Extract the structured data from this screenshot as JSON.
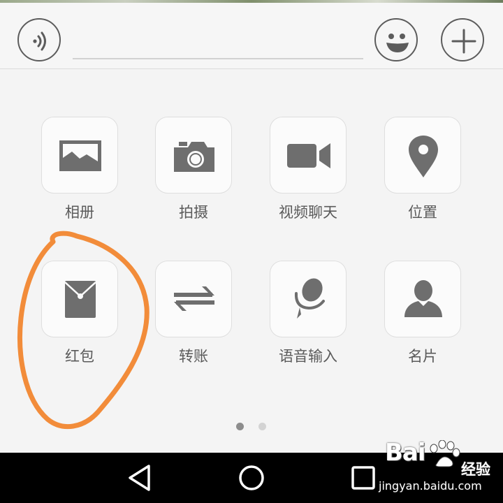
{
  "apps": [
    {
      "label": "相册",
      "icon": "image-icon"
    },
    {
      "label": "拍摄",
      "icon": "camera-icon"
    },
    {
      "label": "视频聊天",
      "icon": "video-camera-icon"
    },
    {
      "label": "位置",
      "icon": "location-pin-icon"
    },
    {
      "label": "红包",
      "icon": "red-envelope-icon"
    },
    {
      "label": "转账",
      "icon": "transfer-arrows-icon"
    },
    {
      "label": "语音输入",
      "icon": "microphone-icon"
    },
    {
      "label": "名片",
      "icon": "contact-card-icon"
    }
  ],
  "pagination": {
    "pages": 2,
    "current": 1
  },
  "watermark": {
    "brand": "Bai",
    "brand_suffix": "经验",
    "url": "jingyan.baidu.com"
  },
  "colors": {
    "icon": "#6e6e6e",
    "annotation": "#f28c3a",
    "nav_background": "#000000"
  }
}
